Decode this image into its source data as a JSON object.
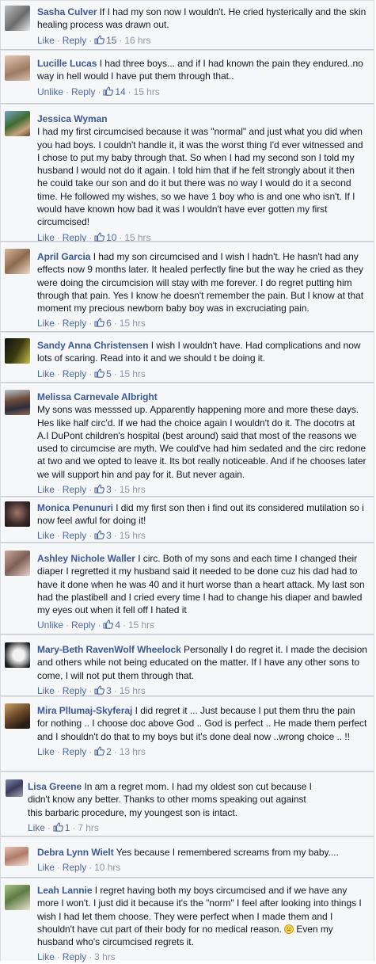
{
  "labels": {
    "like": "Like",
    "unlike": "Unlike",
    "reply": "Reply",
    "dot": "·"
  },
  "colors": {
    "name": "#3b5998",
    "link": "#4e69a2",
    "meta": "#9197a3",
    "text": "#141823"
  },
  "comments": [
    {
      "name": "Sasha Culver",
      "text": "If I had my son now I wouldn't. He cried hysterically and the skin healing process was drawn out.",
      "action": "Like",
      "likes": "15",
      "time": "16 hrs"
    },
    {
      "name": "Lucille Lucas",
      "text": "I had three boys... and if I had known the pain they endured..no way in hell would I have put them through that..",
      "action": "Unlike",
      "likes": "14",
      "time": "15 hrs"
    },
    {
      "name": "Jessica Wyman",
      "text": "I had my first circumcised because it was \"normal\" and just what you did when you had boys. I couldn't handle it, it was the worst thing I'd ever witnessed and I chose to put my baby through that. So when I had my second son I told my husband I would not do it again. I told him that if he felt strongly about it then he could take our son and do it but there was no way I would do it a second time. He followed my wishes, so we have 1 boy who is and one who isn't. If I would have known how bad it was I wouldn't have ever gotten my first circumcised!",
      "action": "Like",
      "likes": "10",
      "time": "15 hrs"
    },
    {
      "name": "April Garcia",
      "text": "I had my son circumcised and I wish I hadn't. He hasn't had any effects now 9 months later. It healed perfectly fine but the way he cried as they were doing the circumcision will stay with me forever. I do regret putting him through that pain. Yes I know he doesn't remember the pain. But I know at that moment my precious newborn baby boy was in excruciating pain.",
      "action": "Like",
      "likes": "6",
      "time": "15 hrs"
    },
    {
      "name": "Sandy Anna Christensen",
      "text": "I wish I wouldn't have. Had complications and now lots of scaring. Read into it and we should t be doing it.",
      "action": "Like",
      "likes": "5",
      "time": "15 hrs"
    },
    {
      "name": "Melissa Carnevale Albright",
      "text": "My sons was messsed up. Apparently happening more and more these days. Hes like half circ'd. If we had the choice again I wouldn't do it. The docotrs at A.I DuPont children's hospital (best around) said that most of the reasons we used to circumcise are myth. We could've had him sedated and the circ redone at two and we opted to leave it. Its bot really noticeable. And if he chooses later we will support hin and pay for it. But never again.",
      "action": "Like",
      "likes": "3",
      "time": "15 hrs"
    },
    {
      "name": "Monica Penunuri",
      "text": "I did my first son then i find out its considered mutilation so i now feel awful for doing it!",
      "action": "Like",
      "likes": "3",
      "time": "15 hrs"
    },
    {
      "name": "Ashley Nichole Waller",
      "text": "I circ. Both of my sons and each time I changed their diaper I regretted it my husband said it needed to be done cuz his dad had to have it done when he was 40 and it hurt worse than a heart attack. My last son had the plastibell and I cried every time I had to change his diaper and bawled my eyes out when it fell off I hated it",
      "action": "Unlike",
      "likes": "4",
      "time": "15 hrs"
    },
    {
      "name": "Mary-Beth RavenWolf Wheelock",
      "text": "Personally I do regret it. I made the decision and others while not being educated on the matter. If I have any other sons to come, I will not put them through that.",
      "action": "Like",
      "likes": "3",
      "time": "15 hrs"
    },
    {
      "name": "Mira Pllumaj-Skyferaj",
      "text": "I did regret it ... Just because I put them thru the pain for nothing .. I choose doc above God .. God is perfect .. He made them perfect and I shouldn't do that to my boys but it's done deal now ..wrong choice .. !!",
      "action": "Like",
      "likes": "2",
      "time": "13 hrs"
    },
    {
      "name": "Lisa Greene",
      "text": "In am a regret mom. I had my oldest son cut because I didn't know any better. Thanks to other moms speaking out against this barbaric procedure, my youngest son is intact.",
      "action": "Like",
      "likes": "1",
      "time": "7 hrs"
    },
    {
      "name": "Debra Lynn Wielt",
      "text": "Yes because I remembered screams from my baby....",
      "action": "Like",
      "likes": "",
      "time": "10 hrs"
    },
    {
      "name": "Leah Lannie",
      "text": "I regret having both my boys circumcised and if we have any more I won't. I just did it because it's the \"norm\" I feel after looking into things I wish I had let them choose. They were perfect when I made them and I shouldn't have cut part of their body for no medical reason.",
      "text_after_emoji": "Even my husband who's circumcised regrets it.",
      "action": "Like",
      "likes": "",
      "time": "3 hrs"
    }
  ]
}
